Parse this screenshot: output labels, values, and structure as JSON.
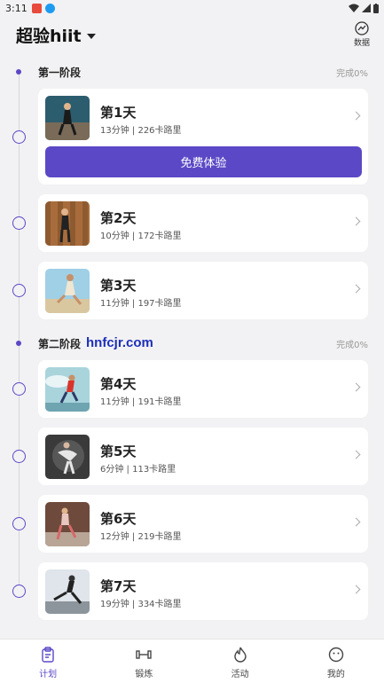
{
  "status_bar": {
    "time": "3:11"
  },
  "header": {
    "title": "超验hiit",
    "data_label": "数据"
  },
  "stages": [
    {
      "title": "第一阶段",
      "progress": "完成0%"
    },
    {
      "title": "第二阶段",
      "progress": "完成0%"
    }
  ],
  "days": [
    {
      "title": "第1天",
      "meta": "13分钟 | 226卡路里"
    },
    {
      "title": "第2天",
      "meta": "10分钟 | 172卡路里"
    },
    {
      "title": "第3天",
      "meta": "11分钟 | 197卡路里"
    },
    {
      "title": "第4天",
      "meta": "11分钟 | 191卡路里"
    },
    {
      "title": "第5天",
      "meta": "6分钟 | 113卡路里"
    },
    {
      "title": "第6天",
      "meta": "12分钟 | 219卡路里"
    },
    {
      "title": "第7天",
      "meta": "19分钟 | 334卡路里"
    }
  ],
  "trial_button": "免费体验",
  "watermark": "hnfcjr.com",
  "tabs": [
    {
      "label": "计划",
      "icon": "clipboard-icon",
      "active": true
    },
    {
      "label": "锻炼",
      "icon": "dumbbell-icon"
    },
    {
      "label": "活动",
      "icon": "flame-icon"
    },
    {
      "label": "我的",
      "icon": "smiley-icon"
    }
  ],
  "colors": {
    "accent": "#5a48c6",
    "background": "#f2f2f4"
  }
}
